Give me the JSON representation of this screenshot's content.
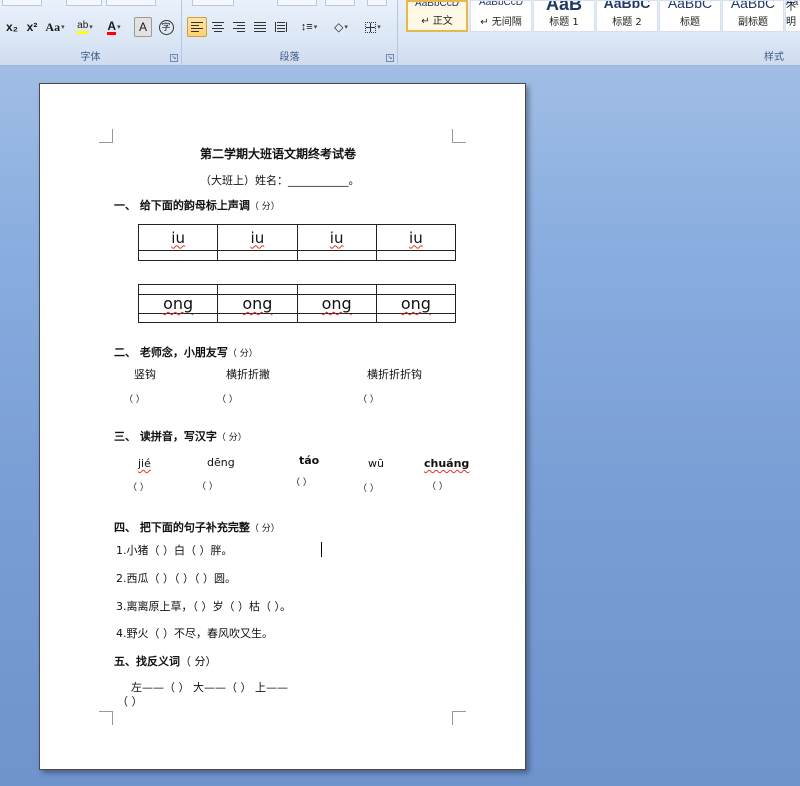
{
  "ribbon": {
    "font_group": {
      "label": "字体",
      "subscript": "x₂",
      "superscript": "x²",
      "change_case": "Aa",
      "highlight": "ab",
      "font_color": "A",
      "char_shading": "A",
      "enclose": "字"
    },
    "paragraph_group": {
      "label": "段落"
    },
    "styles_group": {
      "label": "样式",
      "tiles": [
        {
          "preview": "AaBbCcD",
          "name": "↵ 正文"
        },
        {
          "preview": "AaBbCcD",
          "name": "↵ 无间隔"
        },
        {
          "preview": "AaB",
          "name": "标题 1"
        },
        {
          "preview": "AaBbC",
          "name": "标题 2"
        },
        {
          "preview": "AaBbC",
          "name": "标题"
        },
        {
          "preview": "AaBbC",
          "name": "副标题"
        },
        {
          "preview": "Aa",
          "name": "不明"
        }
      ]
    },
    "colors": {
      "highlight": "#ffff00",
      "font": "#ff0000"
    }
  },
  "doc": {
    "title": "第二学期大班语文期终考试卷",
    "subtitle": "（大班上）姓名：___________。",
    "s1": {
      "heading": "一、  给下面的韵母标上声调",
      "score": "（      分）"
    },
    "grid1": [
      "iu",
      "iu",
      "iu",
      "iu"
    ],
    "grid2": [
      "ong",
      "ong",
      "ong",
      "ong"
    ],
    "s2": {
      "heading": "二、  老师念，小朋友写",
      "score": "（      分）"
    },
    "strokes": [
      "竖钩",
      "横折折撇",
      "横折折折钩"
    ],
    "stroke_blanks": [
      "（          ）",
      "（                ）",
      "（                  ）"
    ],
    "s3": {
      "heading": "三、  读拼音，写汉字",
      "score": "（      分）"
    },
    "pinyin": [
      "jié",
      "dēng",
      "táo",
      "wū",
      "chuáng"
    ],
    "pinyin_blanks": [
      "（          ）",
      "（                  ）",
      "（            ）",
      "（            ）",
      "（                  ）"
    ],
    "s4": {
      "heading": "四、  把下面的句子补充完整",
      "score": "（      分）"
    },
    "sentences": [
      "1.小猪（           ）白（           ）胖。",
      "2.西瓜（           ）（            ）（            ）圆。",
      "3.离离原上草，（           ）岁（           ）枯（           ）。",
      "4.野火（           ）不尽，春风吹又生。"
    ],
    "s5": {
      "heading": "五、找反义词",
      "score": "（      分）"
    },
    "antonyms": "左——（          ）      大——（          ）      上——",
    "antonyms_tail": "（          ）"
  }
}
